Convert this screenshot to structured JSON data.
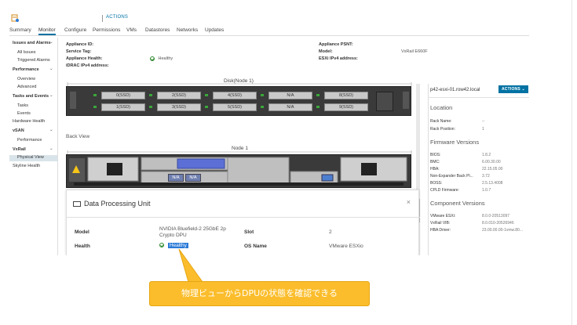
{
  "header": {
    "actions_label": "ACTIONS"
  },
  "tabs": [
    "Summary",
    "Monitor",
    "Configure",
    "Permissions",
    "VMs",
    "Datastores",
    "Networks",
    "Updates"
  ],
  "sidebar": {
    "g1": "Issues and Alarms",
    "g1_items": [
      "All Issues",
      "Triggered Alarms"
    ],
    "g2": "Performance",
    "g2_items": [
      "Overview",
      "Advanced"
    ],
    "g3": "Tasks and Events",
    "g3_items": [
      "Tasks",
      "Events"
    ],
    "hw": "Hardware Health",
    "g4": "vSAN",
    "g4_items": [
      "Performance"
    ],
    "g5": "VxRail",
    "g5_items": [
      "Physical View"
    ],
    "skyline": "Skyline Health"
  },
  "appliance": {
    "id_label": "Appliance ID:",
    "tag_label": "Service Tag:",
    "health_label": "Appliance Health:",
    "health_value": "Healthy",
    "idrac_label": "iDRAC IPv4 address:",
    "psnt_label": "Appliance PSNT:",
    "model_label": "Model:",
    "model_value": "VxRail E660F",
    "esxi_label": "ESXi IPv4 address:"
  },
  "front": {
    "title": "Disk(Node 1)",
    "slots_top": [
      "0(SSD)",
      "2(SSD)",
      "4(SSD)",
      "N/A",
      "8(SSD)"
    ],
    "slots_bottom": [
      "1(SSD)",
      "3(SSD)",
      "5(SSD)",
      "N/A",
      "9(SSD)"
    ]
  },
  "back": {
    "section_label": "Back View",
    "title": "Node 1",
    "na1": "N/A",
    "na2": "N/A"
  },
  "right": {
    "host": "p42-esxi-01.row42.local",
    "actions": "ACTIONS",
    "location_h": "Location",
    "rack_name_l": "Rack Name:",
    "rack_name_v": "--",
    "rack_pos_l": "Rack Position:",
    "rack_pos_v": "1",
    "fw_h": "Firmware Versions",
    "fw": [
      {
        "l": "BIOS:",
        "v": "1.8.2"
      },
      {
        "l": "BMC:",
        "v": "6.00.30.00"
      },
      {
        "l": "HBA:",
        "v": "22.15.05.00"
      },
      {
        "l": "Non-Expander Back Pl...",
        "v": "3.72"
      },
      {
        "l": "BOSS:",
        "v": "2.5.13.4008"
      },
      {
        "l": "CPLD Firmware:",
        "v": "1.0.7"
      }
    ],
    "comp_h": "Component Versions",
    "comp": [
      {
        "l": "VMware ESXi:",
        "v": "8.0.0-20513097"
      },
      {
        "l": "VxRail VIB:",
        "v": "8.0.010-20526946"
      },
      {
        "l": "HBA Driver:",
        "v": "23.00.00.00-1vmw.80..."
      }
    ]
  },
  "dpu": {
    "title": "Data Processing Unit",
    "close": "×",
    "model_l": "Model",
    "model_v1": "NVIDIA Bluefield-2 25GbE 2p",
    "model_v2": "Crypto DPU",
    "slot_l": "Slot",
    "slot_v": "2",
    "health_l": "Health",
    "health_v": "Healthy",
    "os_l": "OS Name",
    "os_v": "VMware ESXio"
  },
  "callout": {
    "text": "物理ビューからDPUの状態を確認できる"
  },
  "colors": {
    "accent": "#0072a3",
    "callout": "#fbbd2b",
    "highlight": "#2a7ad8"
  }
}
